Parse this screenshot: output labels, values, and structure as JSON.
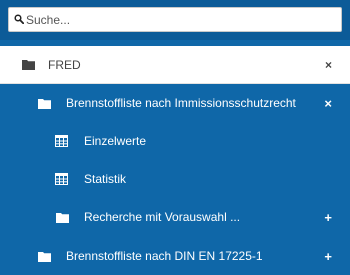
{
  "search": {
    "placeholder": "Suche..."
  },
  "tree": {
    "root": {
      "label": "FRED",
      "action": "×"
    },
    "items": [
      {
        "label": "Brennstoffliste nach Immissionsschutzrecht",
        "action": "×"
      },
      {
        "label": "Einzelwerte"
      },
      {
        "label": "Statistik"
      },
      {
        "label": "Recherche mit Vorauswahl ...",
        "action": "+"
      },
      {
        "label": "Brennstoffliste nach DIN EN 17225-1",
        "action": "+"
      }
    ]
  }
}
